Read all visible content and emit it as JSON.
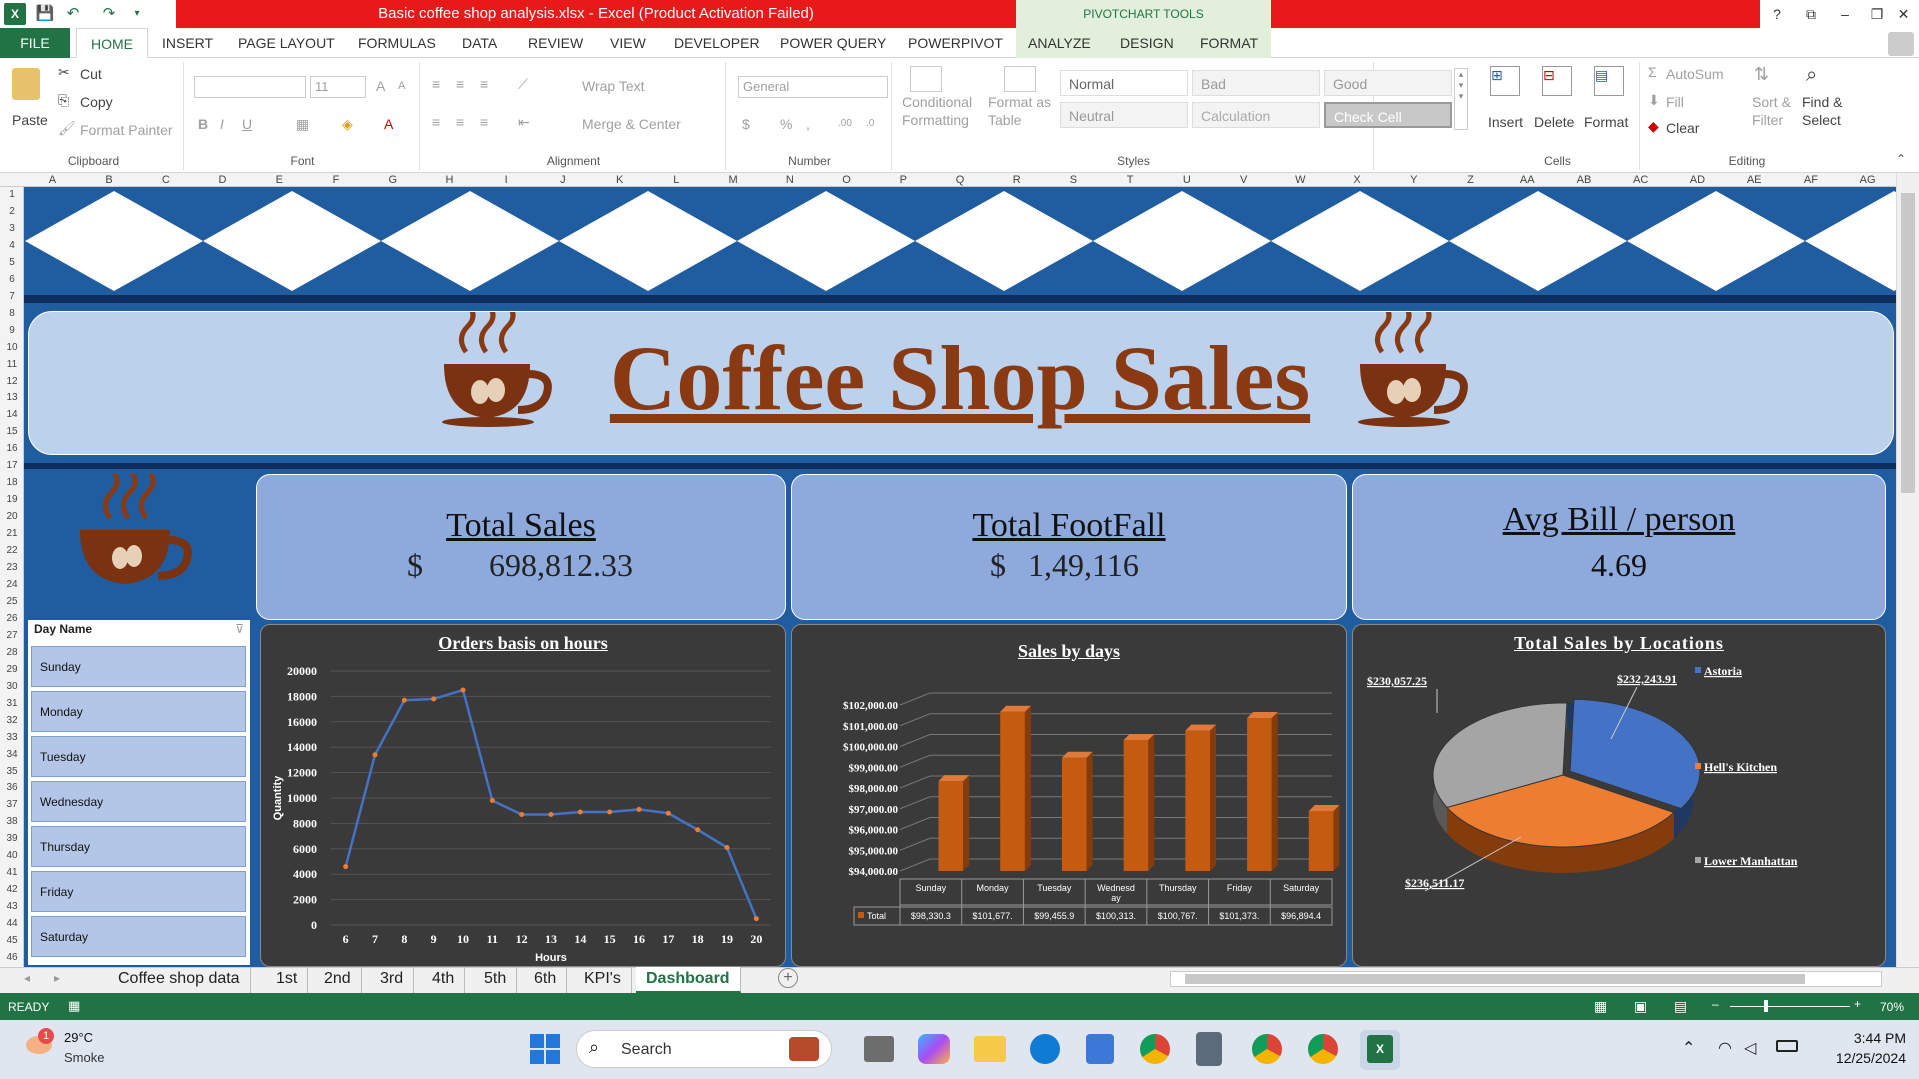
{
  "window": {
    "title": "Basic coffee shop analysis.xlsx  -  Excel (Product Activation Failed)",
    "context_tools": "PIVOTCHART TOOLS",
    "help": "?",
    "restore": "⧉",
    "minimize": "–",
    "maximize": "❐",
    "close": "✕"
  },
  "ribbon_tabs": [
    "FILE",
    "HOME",
    "INSERT",
    "PAGE LAYOUT",
    "FORMULAS",
    "DATA",
    "REVIEW",
    "VIEW",
    "DEVELOPER",
    "POWER QUERY",
    "POWERPIVOT",
    "ANALYZE",
    "DESIGN",
    "FORMAT"
  ],
  "ribbon": {
    "clipboard": {
      "paste": "Paste",
      "cut": "Cut",
      "copy": "Copy",
      "format_painter": "Format Painter",
      "label": "Clipboard"
    },
    "font": {
      "size": "11",
      "label": "Font"
    },
    "alignment": {
      "wrap": "Wrap Text",
      "merge": "Merge & Center",
      "label": "Alignment"
    },
    "number": {
      "format": "General",
      "label": "Number"
    },
    "styles": {
      "conditional": "Conditional",
      "conditional2": "Formatting",
      "format_as": "Format as",
      "format_as2": "Table",
      "normal": "Normal",
      "bad": "Bad",
      "good": "Good",
      "neutral": "Neutral",
      "calculation": "Calculation",
      "check_cell": "Check Cell",
      "label": "Styles"
    },
    "cells": {
      "insert": "Insert",
      "delete": "Delete",
      "format": "Format",
      "label": "Cells"
    },
    "editing": {
      "autosum": "AutoSum",
      "fill": "Fill",
      "clear": "Clear",
      "sort": "Sort &",
      "sort2": "Filter",
      "find": "Find &",
      "find2": "Select",
      "label": "Editing"
    }
  },
  "columns": [
    "A",
    "B",
    "C",
    "D",
    "E",
    "F",
    "G",
    "H",
    "I",
    "J",
    "K",
    "L",
    "M",
    "N",
    "O",
    "P",
    "Q",
    "R",
    "S",
    "T",
    "U",
    "V",
    "W",
    "X",
    "Y",
    "Z",
    "AA",
    "AB",
    "AC",
    "AD",
    "AE",
    "AF",
    "AG"
  ],
  "rows": [
    "1",
    "2",
    "3",
    "4",
    "5",
    "6",
    "7",
    "8",
    "9",
    "10",
    "11",
    "12",
    "13",
    "14",
    "15",
    "16",
    "17",
    "18",
    "19",
    "20",
    "21",
    "22",
    "23",
    "24",
    "25",
    "26",
    "27",
    "28",
    "29",
    "30",
    "31",
    "32",
    "33",
    "34",
    "35",
    "36",
    "37",
    "38",
    "39",
    "40",
    "41",
    "42",
    "43",
    "44",
    "45",
    "46"
  ],
  "dashboard": {
    "title": "Coffee Shop Sales",
    "kpis": [
      {
        "title": "Total Sales",
        "currency": "$",
        "value": "698,812.33"
      },
      {
        "title": "Total FootFall",
        "currency": "$",
        "value": "1,49,116"
      },
      {
        "title": "Avg Bill / person",
        "value": "4.69"
      }
    ],
    "slicer": {
      "header": "Day Name",
      "items": [
        "Sunday",
        "Monday",
        "Tuesday",
        "Wednesday",
        "Thursday",
        "Friday",
        "Saturday"
      ]
    }
  },
  "chart_data": [
    {
      "type": "line",
      "title": "Orders basis on hours",
      "xlabel": "Hours",
      "ylabel": "Quantity",
      "x": [
        6,
        7,
        8,
        9,
        10,
        11,
        12,
        13,
        14,
        15,
        16,
        17,
        18,
        19,
        20
      ],
      "values": [
        4600,
        13400,
        17700,
        17800,
        18500,
        9800,
        8700,
        8700,
        8900,
        8900,
        9100,
        8800,
        7500,
        6100,
        500
      ],
      "ylim": [
        0,
        20000
      ],
      "yticks": [
        "0",
        "2000",
        "4000",
        "6000",
        "8000",
        "10000",
        "12000",
        "14000",
        "16000",
        "18000",
        "20000"
      ],
      "line_color": "#4472c4"
    },
    {
      "type": "bar",
      "title": "Sales by days",
      "categories": [
        "Sunday",
        "Monday",
        "Tuesday",
        "Wednesd ay",
        "Thursday",
        "Friday",
        "Saturday"
      ],
      "series": [
        {
          "name": "Total",
          "values": [
            98330.3,
            101677,
            99455.9,
            100313,
            100767,
            101373,
            96894.4
          ],
          "labels": [
            "$98,330.3",
            "$101,677.",
            "$99,455.9",
            "$100,313.",
            "$100,767.",
            "$101,373.",
            "$96,894.4"
          ]
        }
      ],
      "ylim": [
        94000,
        102000
      ],
      "yticks": [
        "$94,000.00",
        "$95,000.00",
        "$96,000.00",
        "$97,000.00",
        "$98,000.00",
        "$99,000.00",
        "$100,000.00",
        "$101,000.00",
        "$102,000.00"
      ],
      "bar_color": "#c55a11"
    },
    {
      "type": "pie",
      "title": "Total Sales by Locations",
      "labels": [
        "Astoria",
        "Hell's Kitchen",
        "Lower Manhattan"
      ],
      "values": [
        232243.91,
        236511.17,
        230057.25
      ],
      "value_labels": [
        "$232,243.91",
        "$236,511.17",
        "$230,057.25"
      ],
      "colors": [
        "#4472c4",
        "#ed7d31",
        "#a5a5a5"
      ]
    }
  ],
  "sheet_tabs": [
    "Coffee shop data",
    "1st",
    "2nd",
    "3rd",
    "4th",
    "5th",
    "6th",
    "KPI's",
    "Dashboard"
  ],
  "status": {
    "mode": "READY",
    "zoom": "70%"
  },
  "taskbar": {
    "temp": "29°C",
    "weather": "Smoke",
    "search": "Search",
    "time": "3:44 PM",
    "date": "12/25/2024",
    "badge": "1"
  }
}
